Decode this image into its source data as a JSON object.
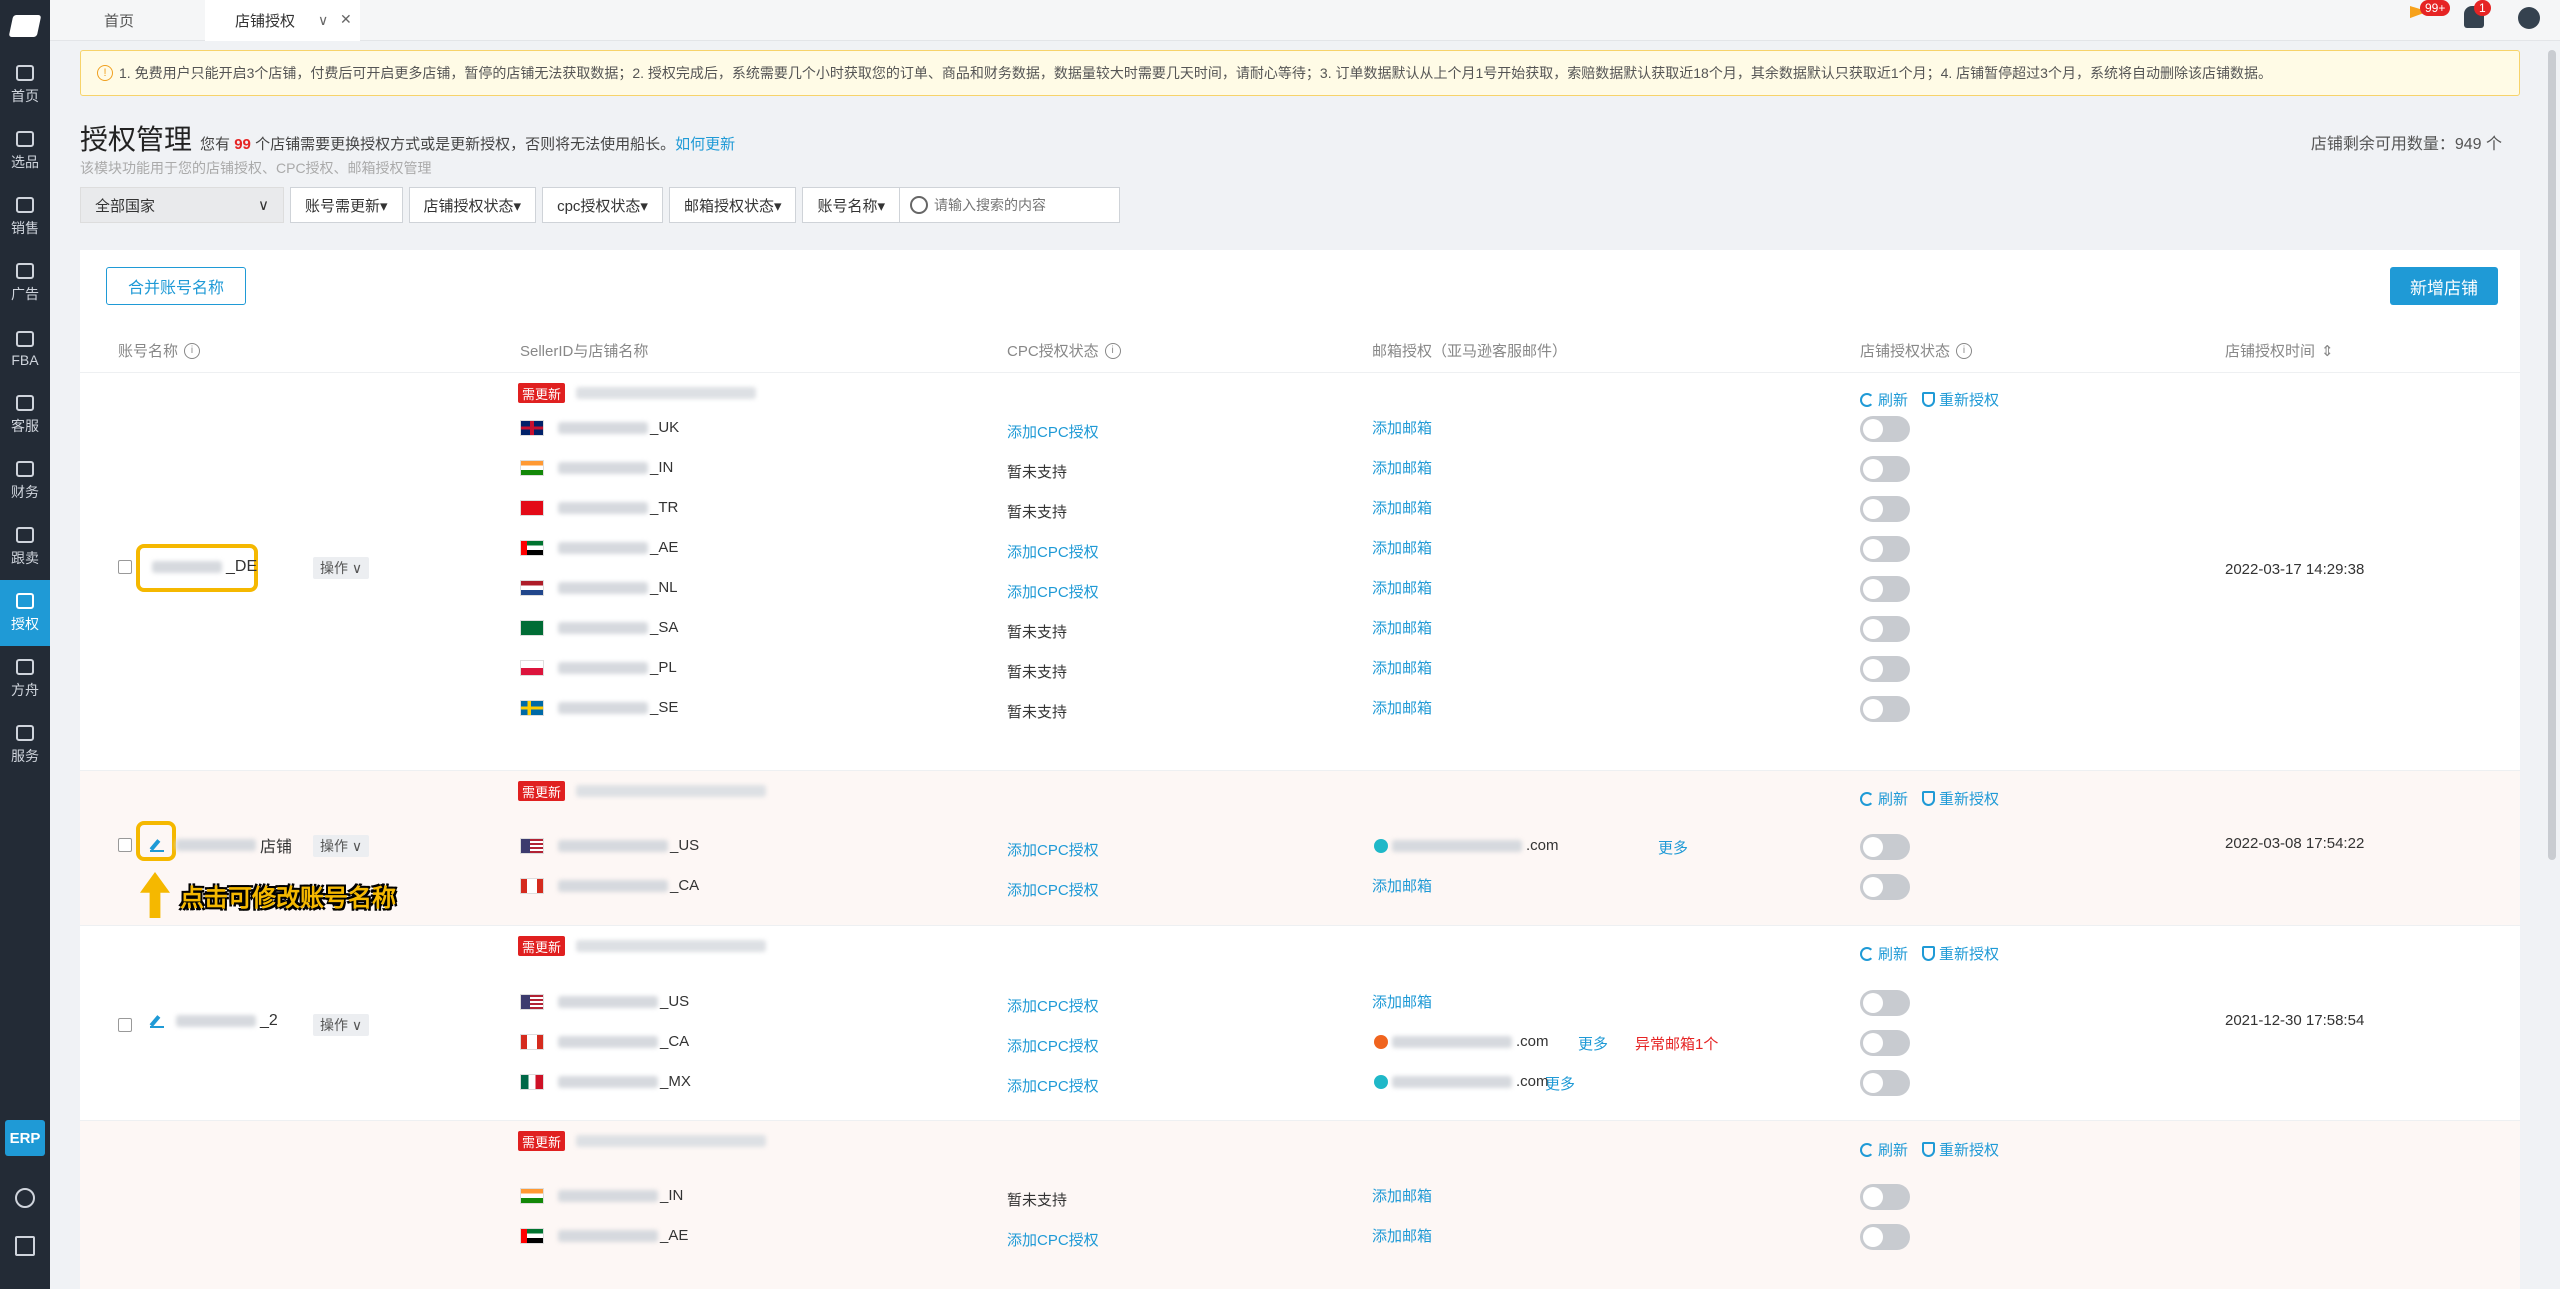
{
  "sidebar": {
    "items": [
      {
        "label": "首页"
      },
      {
        "label": "选品"
      },
      {
        "label": "销售"
      },
      {
        "label": "广告"
      },
      {
        "label": "FBA"
      },
      {
        "label": "客服"
      },
      {
        "label": "财务"
      },
      {
        "label": "跟卖"
      },
      {
        "label": "授权"
      },
      {
        "label": "方舟"
      },
      {
        "label": "服务"
      }
    ],
    "erp": "ERP"
  },
  "tabs": {
    "home": "首页",
    "active": "店铺授权"
  },
  "top": {
    "flag_badge": "99+",
    "bell_badge": "1"
  },
  "notice": "1. 免费用户只能开启3个店铺，付费后可开启更多店铺，暂停的店铺无法获取数据；2. 授权完成后，系统需要几个小时获取您的订单、商品和财务数据，数据量较大时需要几天时间，请耐心等待；3. 订单数据默认从上个月1号开始获取，索赔数据默认获取近18个月，其余数据默认只获取近1个月；4. 店铺暂停超过3个月，系统将自动删除该店铺数据。",
  "header": {
    "title": "授权管理",
    "note_pre": "您有",
    "count": "99",
    "note_post": "个店铺需要更换授权方式或是更新授权，否则将无法使用船长。",
    "how_link": "如何更新",
    "subtitle": "该模块功能用于您的店铺授权、CPC授权、邮箱授权管理",
    "remain": "店铺剩余可用数量：949 个"
  },
  "filters": {
    "country": "全部国家",
    "f1": "账号需更新▾",
    "f2": "店铺授权状态▾",
    "f3": "cpc授权状态▾",
    "f4": "邮箱授权状态▾",
    "f5": "账号名称▾",
    "search_placeholder": "请输入搜索的内容"
  },
  "buttons": {
    "merge": "合并账号名称",
    "add": "新增店铺"
  },
  "columns": {
    "account": "账号名称",
    "seller": "SellerID与店铺名称",
    "cpc": "CPC授权状态",
    "mail": "邮箱授权（亚马逊客服邮件）",
    "status": "店铺授权状态",
    "time": "店铺授权时间"
  },
  "common": {
    "need_update": "需更新",
    "op": "操作 ∨",
    "refresh": "刷新",
    "reauth": "重新授权",
    "add_mail": "添加邮箱",
    "add_cpc": "添加CPC授权",
    "not_supported": "暂未支持",
    "more": "更多",
    "abnormal": "异常邮箱1个",
    "com": ".com"
  },
  "groups": [
    {
      "account_suffix": "_DE",
      "time": "2022-03-17 14:29:38",
      "rows": [
        {
          "suffix": "_UK",
          "cpc": "添加CPC授权"
        },
        {
          "suffix": "_IN",
          "cpc": "暂未支持"
        },
        {
          "suffix": "_TR",
          "cpc": "暂未支持"
        },
        {
          "suffix": "_AE",
          "cpc": "添加CPC授权"
        },
        {
          "suffix": "_NL",
          "cpc": "添加CPC授权"
        },
        {
          "suffix": "_SA",
          "cpc": "暂未支持"
        },
        {
          "suffix": "_PL",
          "cpc": "暂未支持"
        },
        {
          "suffix": "_SE",
          "cpc": "暂未支持"
        }
      ]
    },
    {
      "account_suffix": "店铺",
      "time": "2022-03-08 17:54:22",
      "rows": [
        {
          "suffix": "_US",
          "cpc": "添加CPC授权"
        },
        {
          "suffix": "_CA",
          "cpc": "添加CPC授权"
        }
      ]
    },
    {
      "account_suffix": "_2",
      "time": "2021-12-30 17:58:54",
      "rows": [
        {
          "suffix": "_US",
          "cpc": "添加CPC授权"
        },
        {
          "suffix": "_CA",
          "cpc": "添加CPC授权"
        },
        {
          "suffix": "_MX",
          "cpc": "添加CPC授权"
        }
      ]
    },
    {
      "account_suffix": "",
      "time": "",
      "rows": [
        {
          "suffix": "_IN",
          "cpc": "暂未支持"
        },
        {
          "suffix": "_AE",
          "cpc": "添加CPC授权"
        }
      ]
    }
  ],
  "callout": "点击可修改账号名称",
  "colors": {
    "accent": "#1f9ad6",
    "danger": "#e62424",
    "highlight": "#f5b800"
  }
}
